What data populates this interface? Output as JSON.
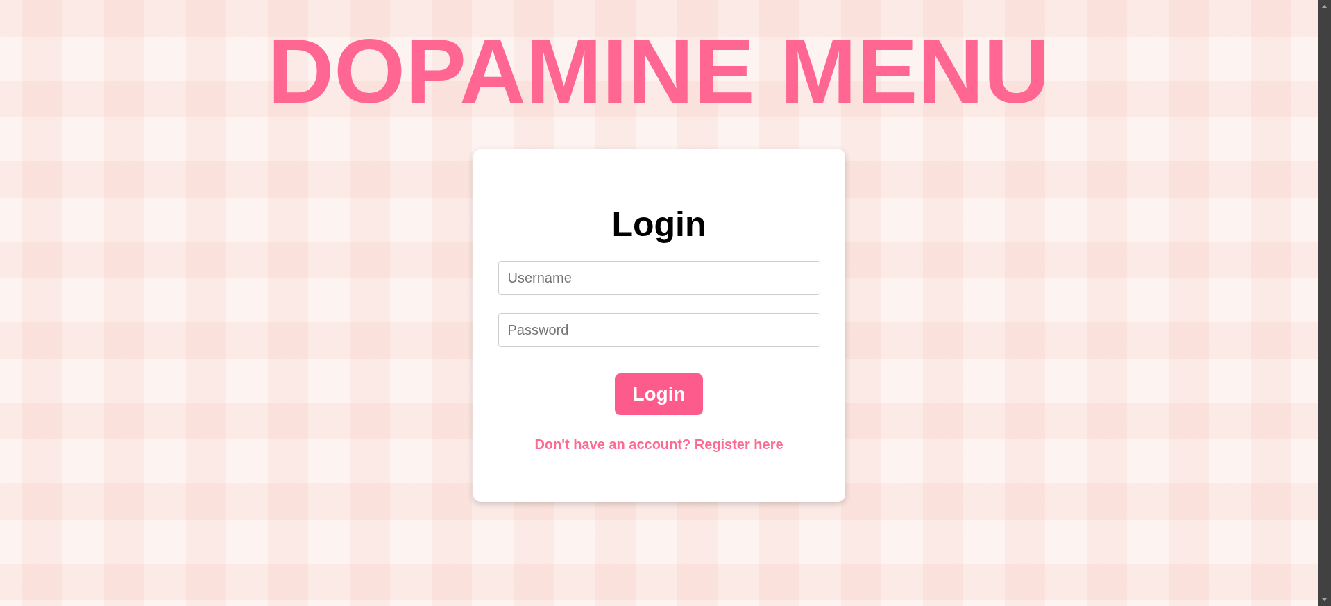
{
  "title": "DOPAMINE MENU",
  "login_form": {
    "heading": "Login",
    "fields": [
      {
        "placeholder": "Username"
      },
      {
        "placeholder": "Password"
      }
    ],
    "submit_button": "Login",
    "register_prompt": {
      "text": "Don't have an account?",
      "link": "Register here"
    }
  }
}
